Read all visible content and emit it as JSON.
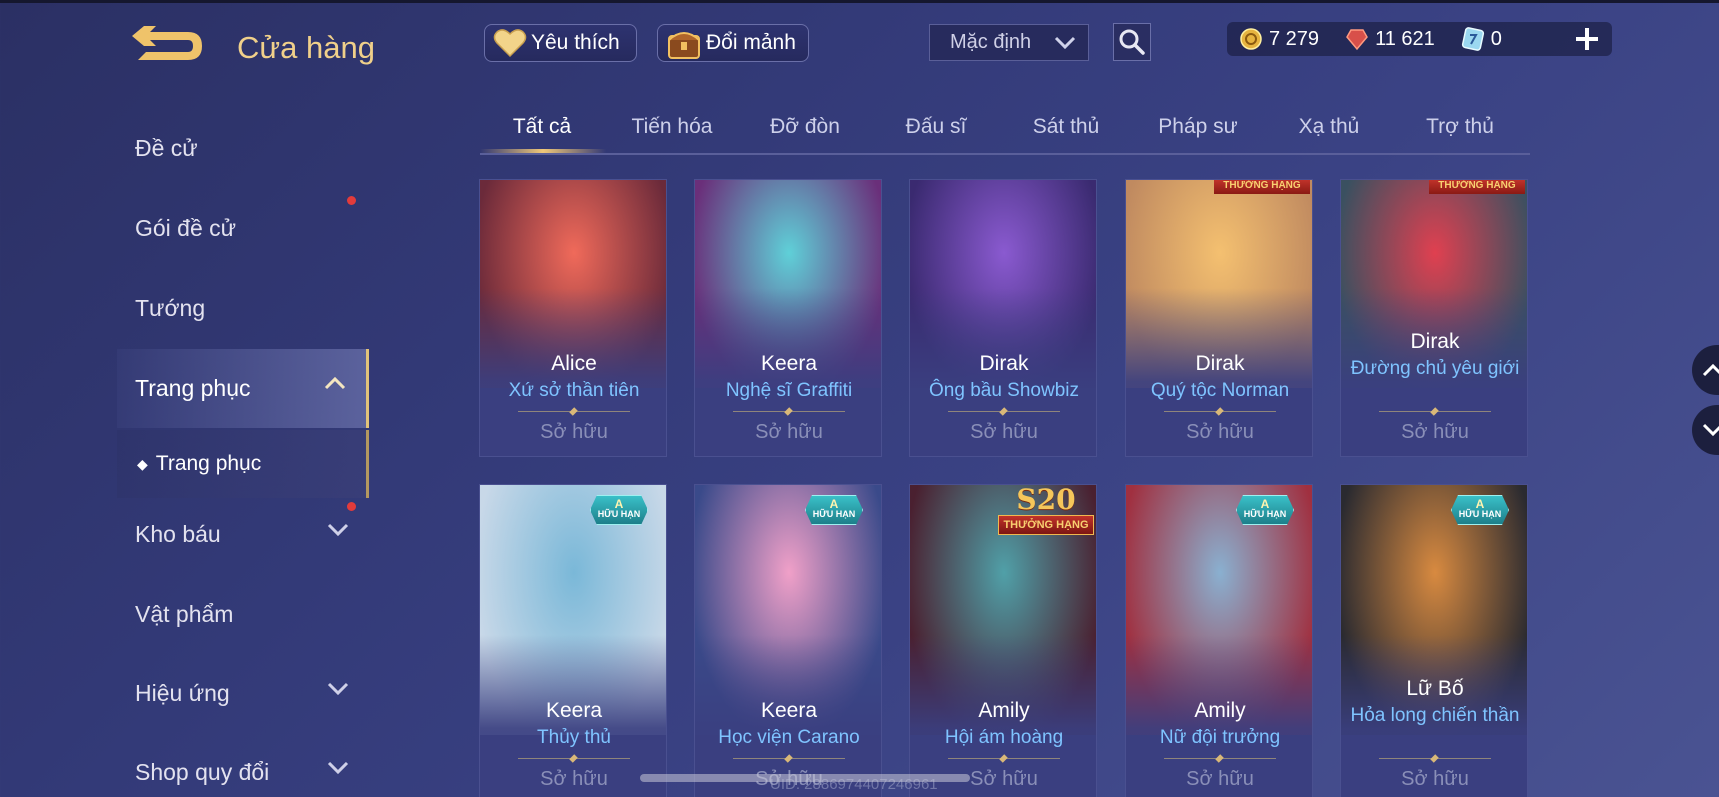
{
  "header": {
    "title": "Cửa hàng",
    "favorite_label": "Yêu thích",
    "trade_label": "Đổi mảnh",
    "sort_value": "Mặc định"
  },
  "currency": {
    "gold": "7 279",
    "gems": "11 621",
    "vouchers": "0"
  },
  "sidebar": {
    "items": [
      {
        "label": "Đề cử"
      },
      {
        "label": "Gói đề cử"
      },
      {
        "label": "Tướng"
      },
      {
        "label": "Trang phục"
      },
      {
        "label": "Kho báu"
      },
      {
        "label": "Vật phẩm"
      },
      {
        "label": "Hiệu ứng"
      },
      {
        "label": "Shop quy đổi"
      }
    ],
    "sub_item": "Trang phục"
  },
  "tabs": [
    "Tất cả",
    "Tiến hóa",
    "Đỡ đòn",
    "Đấu sĩ",
    "Sát thủ",
    "Pháp sư",
    "Xạ thủ",
    "Trợ thủ"
  ],
  "badges": {
    "limited_tier": "A",
    "limited_label": "HỮU HẠN",
    "season": "S20",
    "rank_label": "THƯỞNG HẠNG"
  },
  "cards": [
    {
      "hero": "Alice",
      "skin": "Xứ sở thần tiên",
      "status": "Sở hữu",
      "color_top": "#f06a5a",
      "color_bottom": "#6b2a3a"
    },
    {
      "hero": "Keera",
      "skin": "Nghệ sĩ Graffiti",
      "status": "Sở hữu",
      "color_top": "#5fd0d8",
      "color_bottom": "#6a2f7a"
    },
    {
      "hero": "Dirak",
      "skin": "Ông bầu Showbiz",
      "status": "Sở hữu",
      "color_top": "#8a5ad0",
      "color_bottom": "#3a2a70"
    },
    {
      "hero": "Dirak",
      "skin": "Quý tộc Norman",
      "status": "Sở hữu",
      "color_top": "#f4c070",
      "color_bottom": "#c08a60"
    },
    {
      "hero": "Dirak",
      "skin": "Đường chủ yêu giới",
      "status": "Sở hữu",
      "color_top": "#e04050",
      "color_bottom": "#3a5060"
    },
    {
      "hero": "Keera",
      "skin": "Thủy thủ",
      "status": "Sở hữu",
      "color_top": "#7ab8d8",
      "color_bottom": "#c8d8e8"
    },
    {
      "hero": "Keera",
      "skin": "Học viện Carano",
      "status": "Sở hữu",
      "color_top": "#f0a0c8",
      "color_bottom": "#3a4a8a"
    },
    {
      "hero": "Amily",
      "skin": "Hội ám hoàng",
      "status": "Sở hữu",
      "color_top": "#50a0a8",
      "color_bottom": "#4a2030"
    },
    {
      "hero": "Amily",
      "skin": "Nữ đội trưởng",
      "status": "Sở hữu",
      "color_top": "#8ab0d0",
      "color_bottom": "#a03040"
    },
    {
      "hero": "Lữ Bố",
      "skin": "Hỏa long chiến thần",
      "status": "Sở hữu",
      "color_top": "#d88a40",
      "color_bottom": "#2a2a30"
    }
  ],
  "footer": {
    "uid": "UID: 2886974407246961"
  }
}
